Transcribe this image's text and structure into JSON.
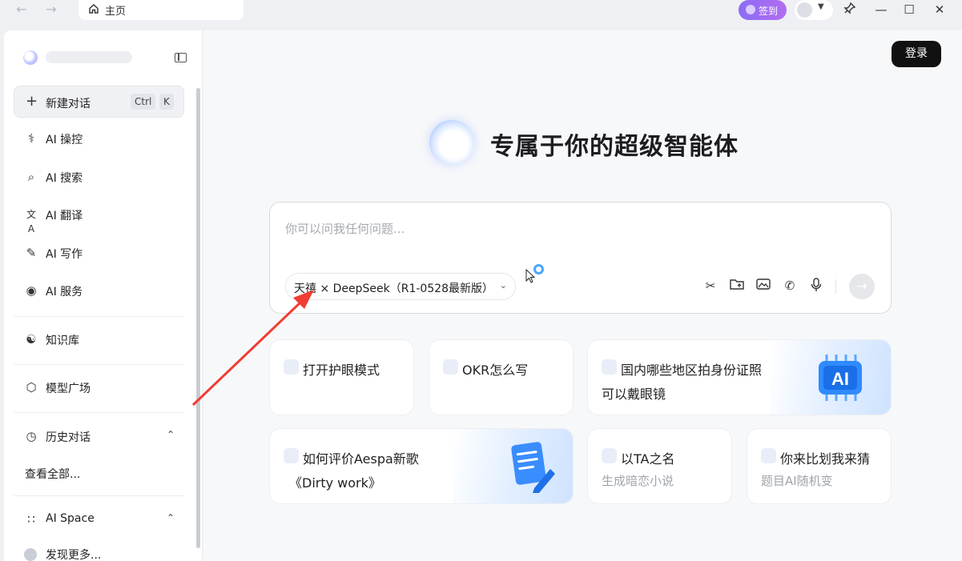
{
  "titlebar": {
    "back_icon": "arrow-left-icon",
    "forward_icon": "arrow-right-icon",
    "tab_label": "主页",
    "sign_in_label": "签到",
    "controls": [
      "pin-icon",
      "minimize-icon",
      "maximize-icon",
      "close-icon"
    ]
  },
  "sidebar": {
    "new_chat": {
      "label": "新建对话",
      "shortcut_ctrl": "Ctrl",
      "shortcut_key": "K"
    },
    "items": [
      {
        "label": "AI 操控",
        "icon": "stethoscope-icon"
      },
      {
        "label": "AI 搜索",
        "icon": "search-icon"
      },
      {
        "label": "AI 翻译",
        "icon": "translate-icon"
      },
      {
        "label": "AI 写作",
        "icon": "pen-icon"
      },
      {
        "label": "AI 服务",
        "icon": "service-icon"
      }
    ],
    "knowledge": "知识库",
    "models": "模型广场",
    "history": {
      "label": "历史对话",
      "view_all": "查看全部..."
    },
    "ai_space": {
      "label": "AI Space",
      "discover": "发现更多..."
    }
  },
  "main": {
    "login_label": "登录",
    "title": "专属于你的超级智能体",
    "input_placeholder": "你可以问我任何问题...",
    "model_label": "天禧 × DeepSeek（R1-0528最新版）",
    "tools": [
      "scissors-icon",
      "folder-upload-icon",
      "image-icon",
      "phone-icon",
      "microphone-icon"
    ],
    "cards": [
      {
        "line1": "打开护眼模式"
      },
      {
        "line1": "OKR怎么写"
      },
      {
        "line1": "国内哪些地区拍身份证照",
        "line2": "可以戴眼镜"
      },
      {
        "line1": "如何评价Aespa新歌",
        "line2": "《Dirty work》"
      },
      {
        "line1": "以TA之名",
        "line2": "生成暗恋小说"
      },
      {
        "line1": "你来比划我来猜",
        "line2": "题目AI随机变"
      }
    ]
  },
  "colors": {
    "sign_gradient": "#8a6cf5",
    "accent_blue": "#4aa5ff",
    "annotation_arrow": "#f03c32"
  }
}
